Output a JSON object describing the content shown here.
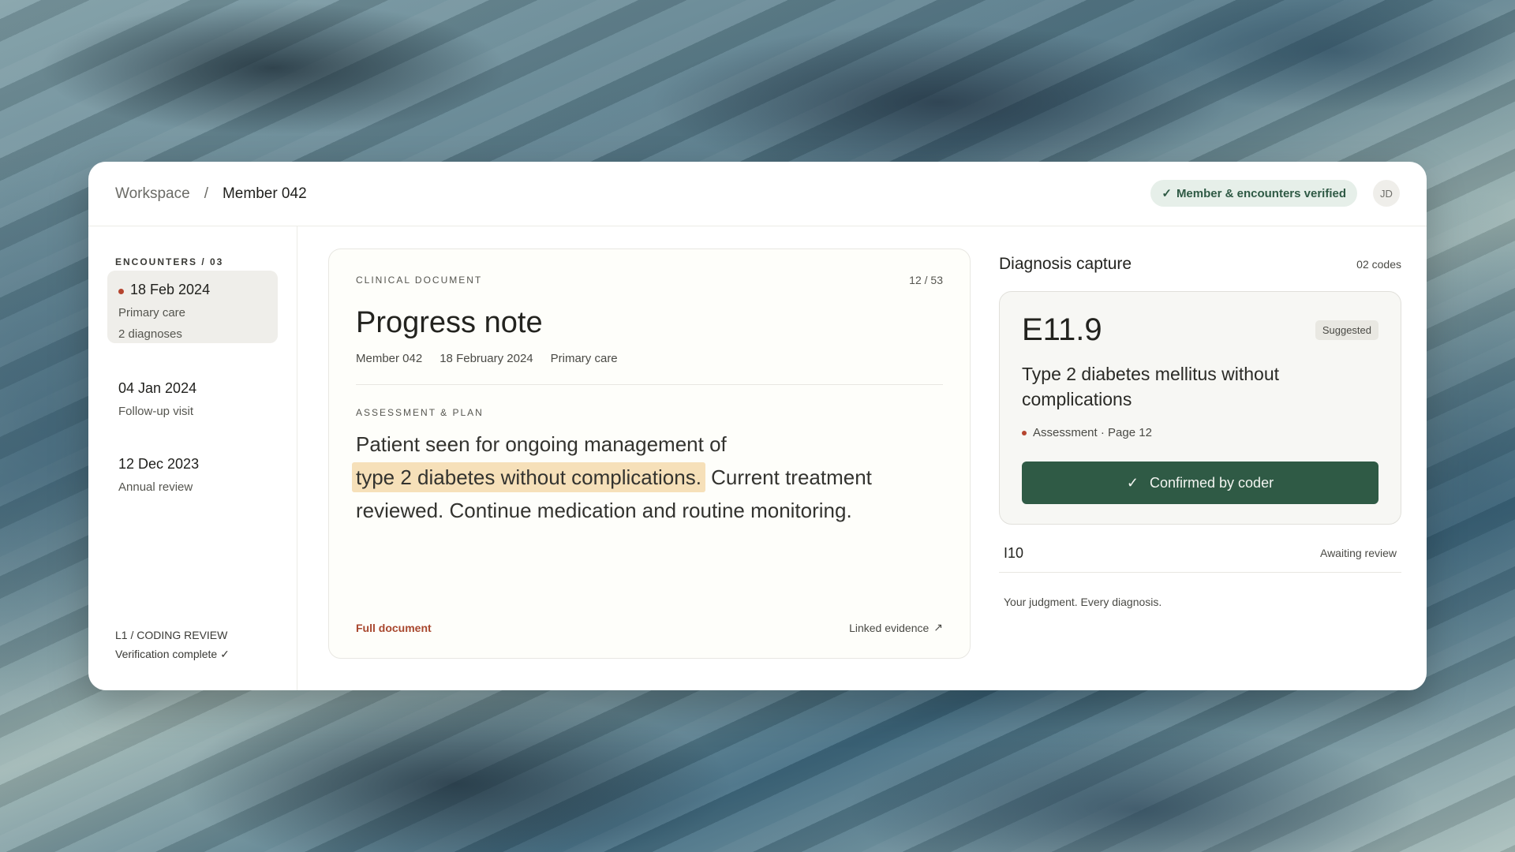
{
  "breadcrumb": {
    "root": "Workspace",
    "separator": "/",
    "current": "Member 042"
  },
  "header": {
    "verified_check": "✓",
    "verified_label": "Member & encounters verified",
    "avatar_initials": "JD"
  },
  "sidebar": {
    "heading": "ENCOUNTERS / 03",
    "encounters": [
      {
        "date": "18 Feb 2024",
        "type": "Primary care",
        "count": "2 diagnoses",
        "active": true
      },
      {
        "date": "04 Jan 2024",
        "type": "Follow-up visit"
      },
      {
        "date": "12 Dec 2023",
        "type": "Annual review"
      }
    ],
    "footer_line1": "L1 / CODING REVIEW",
    "footer_line2": "Verification complete ✓"
  },
  "document": {
    "kicker": "CLINICAL DOCUMENT",
    "page": "12 / 53",
    "title": "Progress note",
    "meta": [
      "Member 042",
      "18 February 2024",
      "Primary care"
    ],
    "section": "ASSESSMENT & PLAN",
    "body_before": "Patient seen for ongoing management of",
    "body_highlight": "type 2 diabetes without complications.",
    "body_after": "Current treatment reviewed. Continue medication and routine monitoring.",
    "full_document_link": "Full document",
    "linked_evidence_link": "Linked evidence",
    "linked_evidence_icon": "↗"
  },
  "diagnosis": {
    "title": "Diagnosis capture",
    "count": "02 codes",
    "primary": {
      "code": "E11.9",
      "badge": "Suggested",
      "description": "Type 2 diabetes mellitus without complications",
      "source": "Assessment · Page 12",
      "confirm_icon": "✓",
      "confirm_label": "Confirmed by coder"
    },
    "secondary": {
      "code": "I10",
      "status": "Awaiting review"
    },
    "tagline": "Your judgment. Every diagnosis."
  },
  "colors": {
    "accent_green": "#2f5a45",
    "accent_red": "#b5452f",
    "highlight": "#f6e0b9"
  }
}
